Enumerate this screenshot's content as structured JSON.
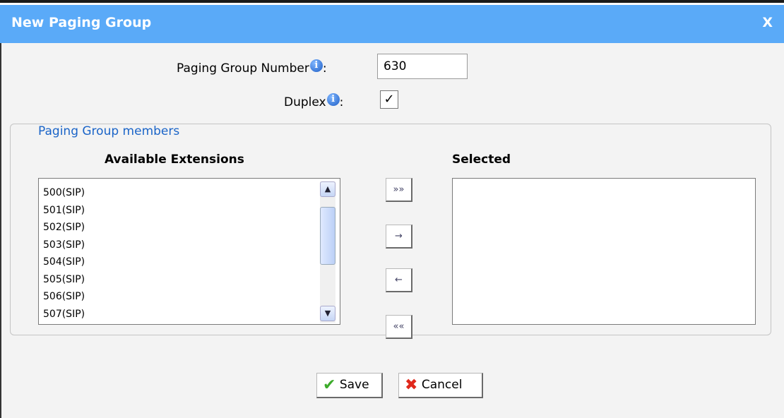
{
  "dialog": {
    "title": "New Paging Group",
    "close_label": "X"
  },
  "form": {
    "number_label": "Paging Group Number",
    "number_value": "630",
    "duplex_label": "Duplex",
    "duplex_checked": true,
    "info_icon": "i",
    "colon": ":"
  },
  "members": {
    "legend": "Paging Group members",
    "available_header": "Available Extensions",
    "selected_header": "Selected",
    "available": [
      "500(SIP)",
      "501(SIP)",
      "502(SIP)",
      "503(SIP)",
      "504(SIP)",
      "505(SIP)",
      "506(SIP)",
      "507(SIP)"
    ],
    "selected": []
  },
  "move_buttons": {
    "add_all": "»»",
    "add_one": "→",
    "remove_one": "←",
    "remove_all": "««"
  },
  "actions": {
    "save_label": "Save",
    "cancel_label": "Cancel"
  },
  "colors": {
    "titlebar": "#5aaaf8",
    "legend_text": "#1a64c8",
    "save_icon": "#3cab2a",
    "cancel_icon": "#e0281b"
  },
  "icons": [
    "info-icon",
    "check-icon",
    "x-icon",
    "scroll-up-icon",
    "scroll-down-icon"
  ]
}
